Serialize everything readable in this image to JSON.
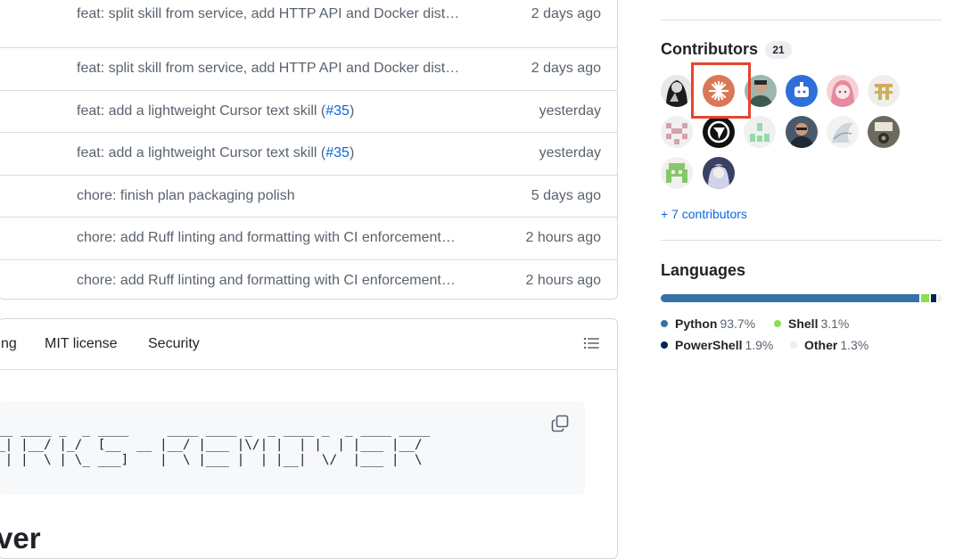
{
  "files": {
    "rows": [
      {
        "message": "feat: split skill from service, add HTTP API and Docker dist…",
        "time": "2 days ago"
      },
      {
        "message": "feat: split skill from service, add HTTP API and Docker dist…",
        "time": "2 days ago"
      },
      {
        "message_before": "feat: add a lightweight Cursor text skill (",
        "link": "#35",
        "message_after": ")",
        "time": "yesterday"
      },
      {
        "message_before": "feat: add a lightweight Cursor text skill (",
        "link": "#35",
        "message_after": ")",
        "time": "yesterday"
      },
      {
        "message": "chore: finish plan packaging polish",
        "time": "5 days ago"
      },
      {
        "message": "chore: add Ruff linting and formatting with CI enforcement…",
        "time": "2 hours ago"
      },
      {
        "message": "chore: add Ruff linting and formatting with CI enforcement…",
        "time": "2 hours ago"
      }
    ]
  },
  "readme": {
    "tabs": [
      {
        "label": "ng"
      },
      {
        "label": "MIT license"
      },
      {
        "label": "Security"
      }
    ],
    "outline_icon": "list-unordered-icon",
    "copy_icon": "copy-icon",
    "ascii_art": "__ ____ _  _ ____     ____ ____ _  _ ____ _  _ ____ ____\n_| |__/ |_/  [__  __ |__/ |___ |\\/| |  | |  | |___ |__/\n | |  \\ | \\_ ___]    |  \\ |___ |  | |__|  \\/  |___ |  \\",
    "heading_fragment": "ver"
  },
  "sidebar": {
    "contributors": {
      "title": "Contributors",
      "count": "21",
      "more_link": "+ 7 contributors"
    },
    "languages": {
      "title": "Languages",
      "items": [
        {
          "name": "Python",
          "percent": "93.7%",
          "share": 93.7,
          "color": "#3572A5"
        },
        {
          "name": "Shell",
          "percent": "3.1%",
          "share": 3.1,
          "color": "#89e051"
        },
        {
          "name": "PowerShell",
          "percent": "1.9%",
          "share": 1.9,
          "color": "#012456"
        },
        {
          "name": "Other",
          "percent": "1.3%",
          "share": 1.3,
          "color": "#ededed"
        }
      ]
    }
  }
}
